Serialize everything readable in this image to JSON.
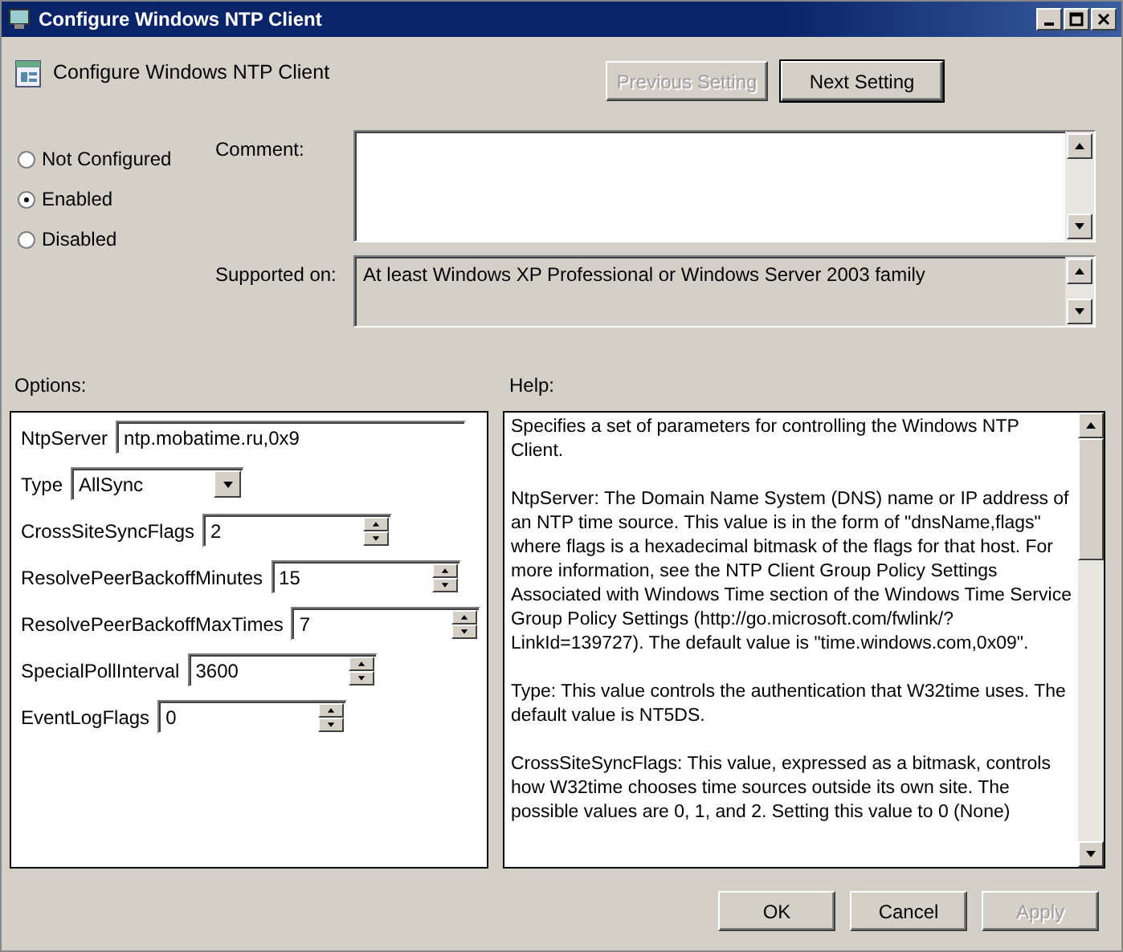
{
  "window": {
    "title": "Configure Windows NTP Client"
  },
  "header": {
    "title": "Configure Windows NTP Client",
    "buttons": [
      {
        "label": "Previous Setting",
        "disabled": true
      },
      {
        "label": "Next Setting",
        "disabled": false
      }
    ]
  },
  "state_options": [
    {
      "label": "Not Configured",
      "selected": false
    },
    {
      "label": "Enabled",
      "selected": true
    },
    {
      "label": "Disabled",
      "selected": false
    }
  ],
  "comment": {
    "label": "Comment:"
  },
  "supported_on": {
    "label": "Supported on:",
    "value": "At least Windows XP Professional or Windows Server 2003 family"
  },
  "options": {
    "label": "Options:",
    "items": [
      {
        "kind": "text",
        "label": "NtpServer",
        "value": "ntp.mobatime.ru,0x9"
      },
      {
        "kind": "dropdown",
        "label": "Type",
        "value": "AllSync"
      },
      {
        "kind": "spinner",
        "label": "CrossSiteSyncFlags",
        "value": "2"
      },
      {
        "kind": "spinner",
        "label": "ResolvePeerBackoffMinutes",
        "value": "15"
      },
      {
        "kind": "spinner",
        "label": "ResolvePeerBackoffMaxTimes",
        "value": "7"
      },
      {
        "kind": "spinner",
        "label": "SpecialPollInterval",
        "value": "3600"
      },
      {
        "kind": "spinner",
        "label": "EventLogFlags",
        "value": "0"
      }
    ]
  },
  "help": {
    "label": "Help:",
    "paragraphs": [
      "Specifies a set of parameters for controlling the Windows NTP Client.",
      "NtpServer: The Domain Name System (DNS) name or IP address of an NTP time source. This value is in the form of \"dnsName,flags\" where flags is a hexadecimal bitmask of the flags for that host. For more information, see the NTP Client Group Policy Settings Associated with Windows Time section of the Windows Time Service Group Policy Settings (http://go.microsoft.com/fwlink/?LinkId=139727). The default value is \"time.windows.com,0x09\".",
      "Type: This value controls the authentication that W32time uses. The default value is NT5DS.",
      "CrossSiteSyncFlags: This value, expressed as a bitmask, controls how W32time chooses time sources outside its own site. The possible values are 0, 1, and 2. Setting this value to 0 (None)"
    ]
  },
  "footer_buttons": [
    {
      "label": "OK",
      "disabled": false
    },
    {
      "label": "Cancel",
      "disabled": false
    },
    {
      "label": "Apply",
      "disabled": true
    }
  ]
}
